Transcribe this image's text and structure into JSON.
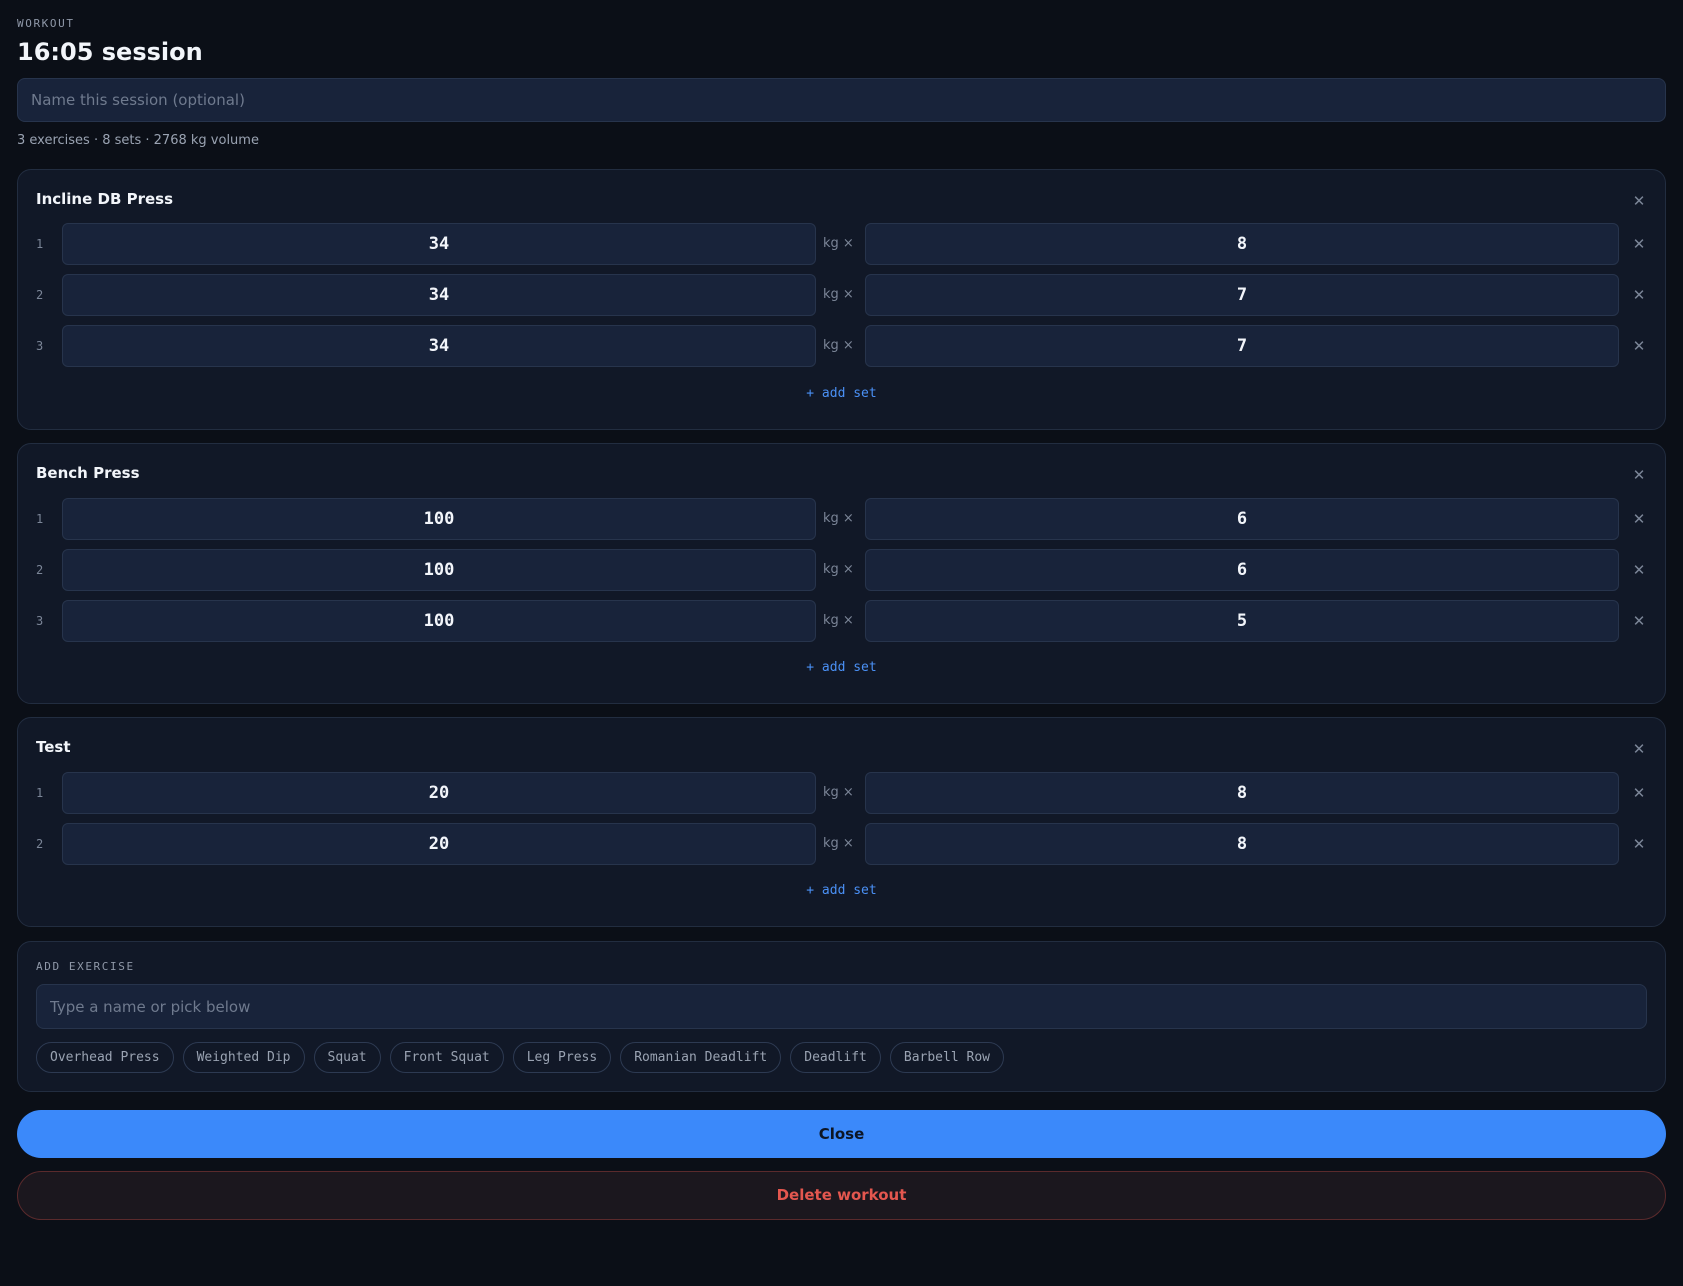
{
  "header": {
    "eyebrow": "WORKOUT",
    "title": "16:05 session",
    "name_placeholder": "Name this session (optional)",
    "summary": "3 exercises · 8 sets · 2768 kg volume"
  },
  "exercises": [
    {
      "name": "Incline DB Press",
      "sets": [
        {
          "index": "1",
          "weight": "34",
          "unit": "kg ×",
          "reps": "8"
        },
        {
          "index": "2",
          "weight": "34",
          "unit": "kg ×",
          "reps": "7"
        },
        {
          "index": "3",
          "weight": "34",
          "unit": "kg ×",
          "reps": "7"
        }
      ],
      "add_set_label": "+ add set"
    },
    {
      "name": "Bench Press",
      "sets": [
        {
          "index": "1",
          "weight": "100",
          "unit": "kg ×",
          "reps": "6"
        },
        {
          "index": "2",
          "weight": "100",
          "unit": "kg ×",
          "reps": "6"
        },
        {
          "index": "3",
          "weight": "100",
          "unit": "kg ×",
          "reps": "5"
        }
      ],
      "add_set_label": "+ add set"
    },
    {
      "name": "Test",
      "sets": [
        {
          "index": "1",
          "weight": "20",
          "unit": "kg ×",
          "reps": "8"
        },
        {
          "index": "2",
          "weight": "20",
          "unit": "kg ×",
          "reps": "8"
        }
      ],
      "add_set_label": "+ add set"
    }
  ],
  "add_exercise": {
    "label": "ADD EXERCISE",
    "placeholder": "Type a name or pick below",
    "suggestions": [
      "Overhead Press",
      "Weighted Dip",
      "Squat",
      "Front Squat",
      "Leg Press",
      "Romanian Deadlift",
      "Deadlift",
      "Barbell Row"
    ]
  },
  "actions": {
    "close_label": "Close",
    "delete_label": "Delete workout"
  },
  "icons": {
    "remove": "close-icon"
  },
  "colors": {
    "accent": "#3b89fa",
    "danger": "#e4574f",
    "background": "#0b0f17",
    "card": "#111827"
  }
}
